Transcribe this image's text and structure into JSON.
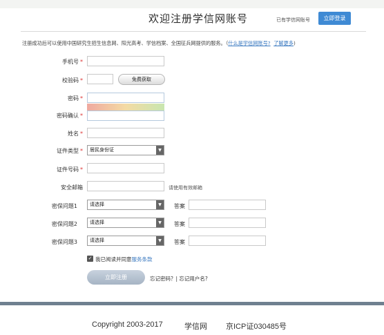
{
  "header": {
    "title": "欢迎注册学信网账号",
    "have_account": "已有学信网账号",
    "login_label": "立即登录"
  },
  "intro": {
    "text": "注册成功后可以使用中国研究生招生信息网、阳光高考、学信档案、全国征兵网提供的服务。（",
    "link1": "什么是学信网账号?",
    "link2": "了解更多"
  },
  "form": {
    "phone_label": "手机号",
    "code_label": "校验码",
    "code_button": "免费获取",
    "password_label": "密码",
    "confirm_label": "密码确认",
    "name_label": "姓名",
    "id_type_label": "证件类型",
    "id_type_value": "居民身份证",
    "id_no_label": "证件号码",
    "email_label": "安全邮箱",
    "email_hint": "请使用有效邮箱",
    "q1_label": "密保问题1",
    "q2_label": "密保问题2",
    "q3_label": "密保问题3",
    "select_placeholder": "请选择",
    "answer_label": "答案",
    "star": "*",
    "agree_text": "我已阅读并同意",
    "agree_link": "服务条款",
    "submit_label": "立即注册",
    "forgot_text": "忘记密码？| 忘记用户名?"
  },
  "footer": {
    "copyright": "Copyright 2003-2017",
    "site": "学信网",
    "icp": "京ICP证030485号"
  },
  "colors": {
    "login_button": "#3f8ad4",
    "link": "#3a79c0",
    "required_star": "#d33333"
  }
}
